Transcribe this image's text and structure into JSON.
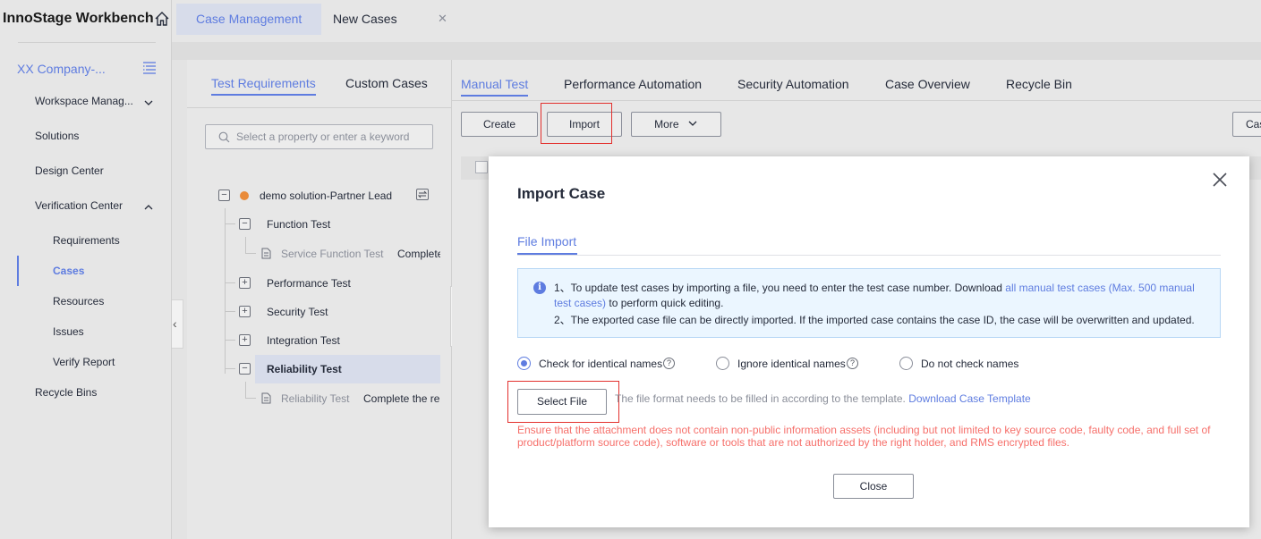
{
  "app": {
    "title": "InnoStage Workbench"
  },
  "top_tabs": [
    {
      "label": "Case Management"
    },
    {
      "label": "New Cases"
    }
  ],
  "sidebar": {
    "company": "XX Company-...",
    "items": [
      {
        "label": "Workspace Manag..."
      },
      {
        "label": "Solutions"
      },
      {
        "label": "Design Center"
      },
      {
        "label": "Verification Center"
      },
      {
        "label": "Requirements"
      },
      {
        "label": "Cases"
      },
      {
        "label": "Resources"
      },
      {
        "label": "Issues"
      },
      {
        "label": "Verify Report"
      },
      {
        "label": "Recycle Bins"
      }
    ]
  },
  "left_panel": {
    "tabs": [
      {
        "label": "Test Requirements"
      },
      {
        "label": "Custom Cases"
      }
    ],
    "search_placeholder": "Select a property or enter a keyword",
    "tree": {
      "root": "demo solution-Partner Lead",
      "nodes": [
        {
          "label": "Function Test",
          "expander": "−"
        },
        {
          "label": "Service Function Test",
          "status": "Complete"
        },
        {
          "label": "Performance Test",
          "expander": "+"
        },
        {
          "label": "Security Test",
          "expander": "+"
        },
        {
          "label": "Integration Test",
          "expander": "+"
        },
        {
          "label": "Reliability Test",
          "expander": "−"
        },
        {
          "label": "Reliability Test",
          "status": "Complete the re"
        }
      ]
    }
  },
  "main": {
    "tabs": [
      {
        "label": "Manual Test"
      },
      {
        "label": "Performance Automation"
      },
      {
        "label": "Security Automation"
      },
      {
        "label": "Case Overview"
      },
      {
        "label": "Recycle Bin"
      }
    ],
    "toolbar": {
      "create": "Create",
      "import": "Import",
      "more": "More",
      "right_button": "Cas"
    }
  },
  "modal": {
    "title": "Import Case",
    "tab": "File Import",
    "info": {
      "line1_prefix": "1、To update test cases by importing a file, you need to enter the test case number. Download ",
      "line1_link": "all manual test cases (Max. 500 manual test cases)",
      "line1_suffix": " to perform quick editing.",
      "line2": "2、The exported case file can be directly imported. If the imported case contains the case ID, the case will be overwritten and updated."
    },
    "options": [
      {
        "label": "Check for identical names",
        "selected": true
      },
      {
        "label": "Ignore identical names",
        "selected": false
      },
      {
        "label": "Do not check names",
        "selected": false
      }
    ],
    "select_file": "Select File",
    "template_hint": "The file format needs to be filled in according to the template.",
    "template_link": "Download Case Template",
    "warning": "Ensure that the attachment does not contain non-public information assets (including but not limited to key source code, faulty code, and full set of product/platform source code), software or tools that are not authorized by the right holder, and RMS encrypted files.",
    "close": "Close"
  },
  "colors": {
    "accent": "#5e7ce0",
    "warning": "#f66f6a",
    "highlight_frame": "#e3302d",
    "tree_dot": "#e98b3a"
  }
}
